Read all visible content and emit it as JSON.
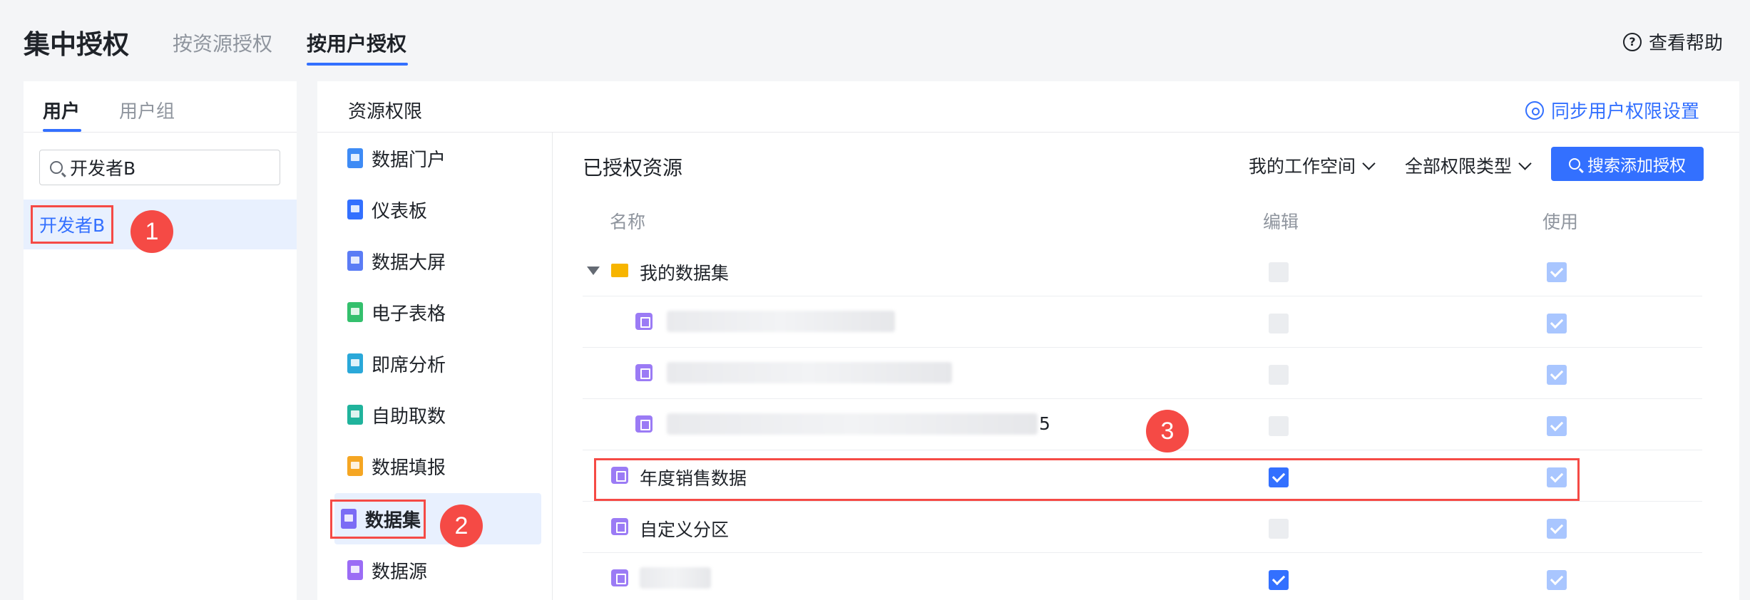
{
  "header": {
    "title": "集中授权",
    "tabs": [
      {
        "label": "按资源授权"
      },
      {
        "label": "按用户授权"
      }
    ],
    "help_label": "查看帮助",
    "help_icon": "?"
  },
  "user_panel": {
    "tabs": [
      {
        "label": "用户"
      },
      {
        "label": "用户组"
      }
    ],
    "search_value": "开发者B",
    "selected_user": "开发者B"
  },
  "main": {
    "title": "资源权限",
    "sync_label": "同步用户权限设置",
    "resource_types": [
      {
        "label": "数据门户",
        "color": "#3e8bf5"
      },
      {
        "label": "仪表板",
        "color": "#3370ff"
      },
      {
        "label": "数据大屏",
        "color": "#5b7cf5"
      },
      {
        "label": "电子表格",
        "color": "#34c06d"
      },
      {
        "label": "即席分析",
        "color": "#2aa8d9"
      },
      {
        "label": "自助取数",
        "color": "#20b39c"
      },
      {
        "label": "数据填报",
        "color": "#f5a623"
      },
      {
        "label": "数据集",
        "color": "#7b6cf5"
      },
      {
        "label": "数据源",
        "color": "#9b6cf5"
      }
    ],
    "auth_title": "已授权资源",
    "workspace_dropdown": "我的工作空间",
    "perm_type_dropdown": "全部权限类型",
    "search_add_label": "搜索添加授权",
    "columns": {
      "name": "名称",
      "edit": "编辑",
      "use": "使用"
    },
    "rows": [
      {
        "label": "我的数据集",
        "edit": "disabled",
        "use": "checked-light"
      },
      {
        "label": "",
        "edit": "disabled",
        "use": "checked-light"
      },
      {
        "label": "",
        "edit": "disabled",
        "use": "checked-light"
      },
      {
        "label": "5",
        "edit": "disabled",
        "use": "checked-light"
      },
      {
        "label": "年度销售数据",
        "edit": "checked",
        "use": "checked-light"
      },
      {
        "label": "自定义分区",
        "edit": "disabled",
        "use": "checked-light"
      },
      {
        "label": "",
        "edit": "checked",
        "use": "checked-light"
      }
    ]
  },
  "callouts": [
    "1",
    "2",
    "3"
  ],
  "colors": {
    "accent": "#3370ff",
    "highlight": "#f54a45"
  }
}
